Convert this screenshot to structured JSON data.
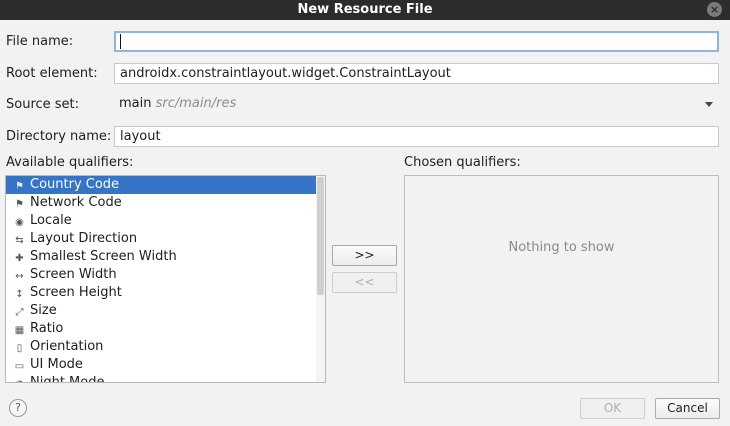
{
  "window": {
    "title": "New Resource File",
    "close_glyph": "×"
  },
  "form": {
    "file_name_label": "File name:",
    "file_name_value": "",
    "root_element_label": "Root element:",
    "root_element_value": "androidx.constraintlayout.widget.ConstraintLayout",
    "source_set_label": "Source set:",
    "source_set_value": "main",
    "source_set_path": "src/main/res",
    "directory_name_label": "Directory name:",
    "directory_name_value": "layout"
  },
  "qualifiers": {
    "available_label": "Available qualifiers:",
    "chosen_label": "Chosen qualifiers:",
    "items": [
      {
        "label": "Country Code",
        "icon": "flag-icon",
        "glyph": "⚑",
        "selected": true
      },
      {
        "label": "Network Code",
        "icon": "network-icon",
        "glyph": "⚑"
      },
      {
        "label": "Locale",
        "icon": "globe-icon",
        "glyph": "◉"
      },
      {
        "label": "Layout Direction",
        "icon": "layout-direction-icon",
        "glyph": "⇆"
      },
      {
        "label": "Smallest Screen Width",
        "icon": "screen-width-icon",
        "glyph": "✚"
      },
      {
        "label": "Screen Width",
        "icon": "width-icon",
        "glyph": "↔"
      },
      {
        "label": "Screen Height",
        "icon": "height-icon",
        "glyph": "↕"
      },
      {
        "label": "Size",
        "icon": "size-icon",
        "glyph": "⤢"
      },
      {
        "label": "Ratio",
        "icon": "ratio-icon",
        "glyph": "▦"
      },
      {
        "label": "Orientation",
        "icon": "orientation-icon",
        "glyph": "▯"
      },
      {
        "label": "UI Mode",
        "icon": "ui-mode-icon",
        "glyph": "▭"
      },
      {
        "label": "Night Mode",
        "icon": "night-mode-icon",
        "glyph": "◑"
      }
    ],
    "add_label": ">>",
    "remove_label": "<<",
    "empty_text": "Nothing to show"
  },
  "footer": {
    "help_glyph": "?",
    "ok_label": "OK",
    "cancel_label": "Cancel"
  }
}
